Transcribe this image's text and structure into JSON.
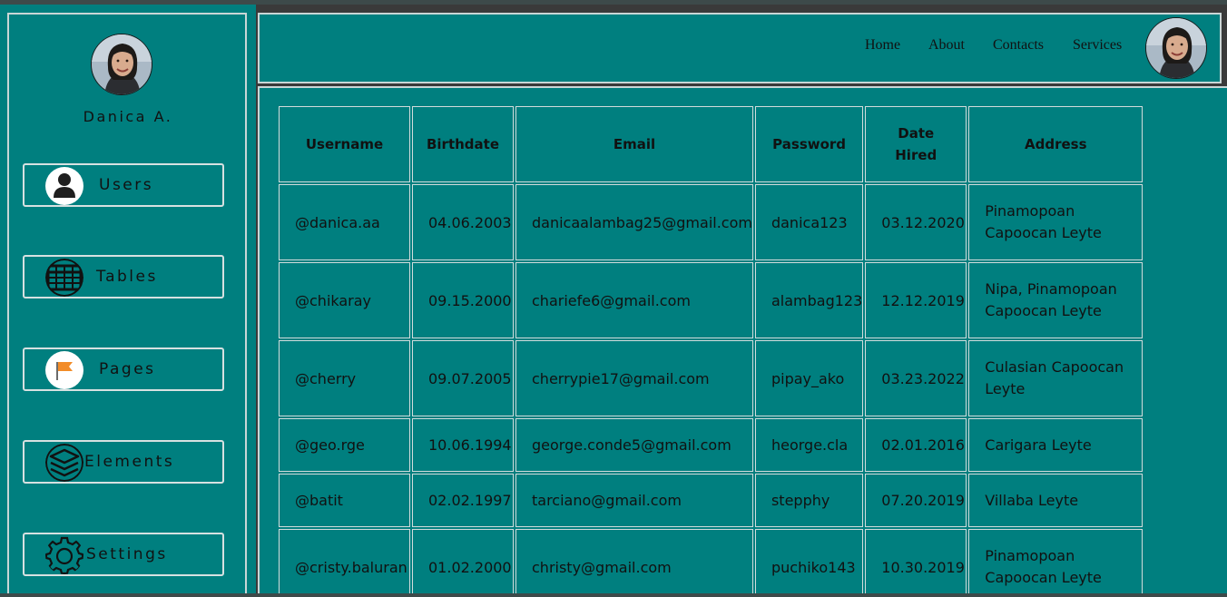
{
  "profile": {
    "name": "Danica A."
  },
  "sidebar": {
    "items": [
      {
        "label": "Users",
        "icon": "user-icon"
      },
      {
        "label": "Tables",
        "icon": "table-grid-icon"
      },
      {
        "label": "Pages",
        "icon": "flag-icon"
      },
      {
        "label": "Elements",
        "icon": "layers-icon"
      },
      {
        "label": "Settings",
        "icon": "gear-icon"
      }
    ]
  },
  "nav": {
    "home": "Home",
    "about": "About",
    "contacts": "Contacts",
    "services": "Services"
  },
  "table": {
    "headers": [
      "Username",
      "Birthdate",
      "Email",
      "Password",
      "Date Hired",
      "Address"
    ],
    "rows": [
      [
        "@danica.aa",
        "04.06.2003",
        "danicaalambag25@gmail.com",
        "danica123",
        "03.12.2020",
        "Pinamopoan Capoocan Leyte"
      ],
      [
        "@chikaray",
        "09.15.2000",
        "chariefe6@gmail.com",
        "alambag123",
        "12.12.2019",
        "Nipa, Pinamopoan Capoocan Leyte"
      ],
      [
        "@cherry",
        "09.07.2005",
        "cherrypie17@gmail.com",
        "pipay_ako",
        "03.23.2022",
        "Culasian Capoocan Leyte"
      ],
      [
        "@geo.rge",
        "10.06.1994",
        "george.conde5@gmail.com",
        "heorge.cla",
        "02.01.2016",
        "Carigara Leyte"
      ],
      [
        "@batit",
        "02.02.1997",
        "tarciano@gmail.com",
        "stepphy",
        "07.20.2019",
        "Villaba Leyte"
      ],
      [
        "@cristy.baluran",
        "01.02.2000",
        "christy@gmail.com",
        "puchiko143",
        "10.30.2019",
        "Pinamopoan Capoocan Leyte"
      ]
    ]
  },
  "colors": {
    "background": "#007f7f",
    "border": "#c9d6d6",
    "text": "#111111"
  }
}
